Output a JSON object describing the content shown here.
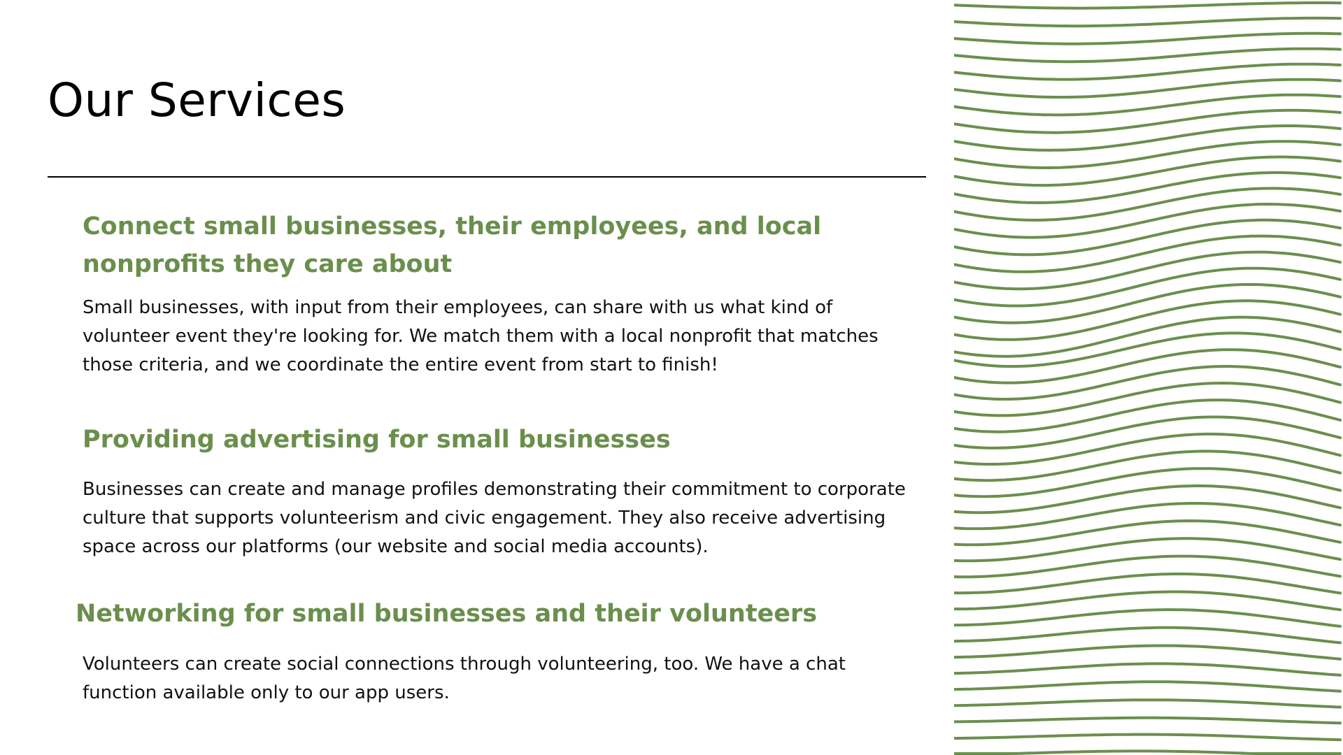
{
  "slide": {
    "title": "Our Services",
    "sections": [
      {
        "heading": "Connect small businesses, their employees, and local nonprofits they care about",
        "body": "Small businesses, with input from their employees, can share with us what kind of volunteer event they're looking for. We match them with a local nonprofit that matches those criteria, and we coordinate the entire event from start to finish!"
      },
      {
        "heading": "Providing advertising for small businesses",
        "body": "Businesses can create and manage profiles demonstrating their commitment to corporate culture that supports volunteerism and civic engagement. They also receive advertising space across our platforms (our website and social media accounts)."
      },
      {
        "heading": "Networking for small businesses and their volunteers",
        "body": "Volunteers can create social connections through volunteering, too. We have a chat function available only to our app users."
      }
    ]
  },
  "theme": {
    "accent": "#6a8f4c",
    "text": "#111111",
    "background": "#ffffff"
  },
  "decoration": {
    "icon": "wavy-lines-pattern"
  }
}
